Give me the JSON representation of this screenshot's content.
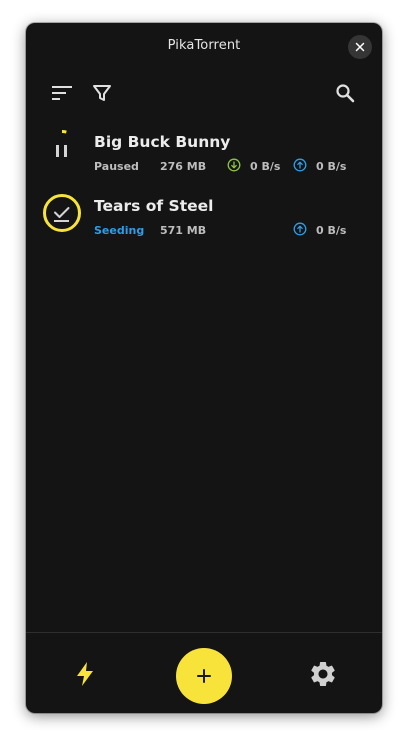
{
  "window": {
    "title": "PikaTorrent"
  },
  "toolbar": {
    "sort_icon": "sort-icon",
    "filter_icon": "filter-icon",
    "search_icon": "search-icon"
  },
  "torrents": [
    {
      "name": "Big Buck Bunny",
      "status": "Paused",
      "size": "276 MB",
      "download_speed": "0 B/s",
      "upload_speed": "0 B/s",
      "state_icon": "pause-icon",
      "progress_fraction": 0.04
    },
    {
      "name": "Tears of Steel",
      "status": "Seeding",
      "size": "571 MB",
      "upload_speed": "0 B/s",
      "state_icon": "check-done-icon",
      "progress_fraction": 1.0
    }
  ],
  "bottom_bar": {
    "left_icon": "lightning-icon",
    "fab_icon": "plus-icon",
    "right_icon": "gear-icon"
  },
  "colors": {
    "background": "#141414",
    "accent_yellow": "#f8e33b",
    "seeding_blue": "#2e9de6",
    "download_green": "#8bc34a",
    "upload_blue": "#2e9de6",
    "text_primary": "#ececec",
    "text_secondary": "#bdbdbd"
  }
}
